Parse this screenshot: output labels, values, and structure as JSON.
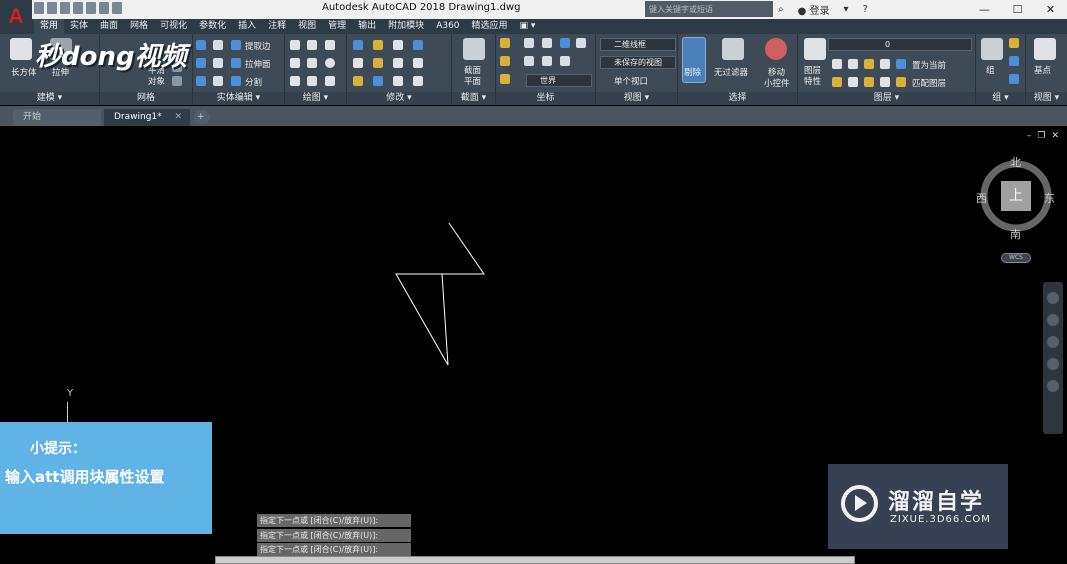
{
  "title_bar": {
    "app_letter": "A",
    "title": "Autodesk AutoCAD 2018    Drawing1.dwg",
    "search_placeholder": "键入关键字或短语",
    "login": "登录",
    "window_controls": [
      "—",
      "☐",
      "✕"
    ]
  },
  "ribbon_tabs": [
    "常用",
    "实体",
    "曲面",
    "网格",
    "可视化",
    "参数化",
    "插入",
    "注释",
    "视图",
    "管理",
    "输出",
    "附加模块",
    "A360",
    "精选应用"
  ],
  "ribbon": {
    "logo_text": "秒dong视频",
    "modeling": {
      "label": "建模 ▾",
      "box": "长方体",
      "extrude": "拉伸"
    },
    "mesh": {
      "label": "网格",
      "smooth": "平滑",
      "object": "对象"
    },
    "solid_edit": {
      "label": "实体编辑 ▾",
      "extract": "提取边",
      "extrude_face": "拉伸面",
      "split": "分割"
    },
    "draw": {
      "label": "绘图 ▾"
    },
    "modify": {
      "label": "修改 ▾"
    },
    "section": {
      "label": "截面 ▾",
      "plane1": "截面",
      "plane2": "平面"
    },
    "coordinates": {
      "label": "坐标",
      "world": "世界"
    },
    "view": {
      "label": "视图 ▾",
      "visual_style": "二维线框",
      "saved_view": "未保存的视图",
      "viewports": "单个视口"
    },
    "selection": {
      "label": "选择",
      "culling": "剔除",
      "no_filter": "无过滤器",
      "gizmo1": "移动",
      "gizmo2": "小控件"
    },
    "layers": {
      "label": "图层 ▾",
      "props1": "图层",
      "props2": "特性",
      "current_layer": "0",
      "set_current": "置为当前",
      "match": "匹配图层"
    },
    "groups": {
      "label": "组 ▾",
      "group": "组"
    },
    "view2": {
      "label": "视图 ▾",
      "base": "基点"
    }
  },
  "doc_tabs": [
    "开始",
    "Drawing1*"
  ],
  "viewport_controls": [
    "–",
    "❐",
    "✕"
  ],
  "viewcube": {
    "north": "北",
    "south": "南",
    "east": "东",
    "west": "西",
    "top": "上",
    "wcs": "WCS"
  },
  "ucs_y": "Y",
  "tip": {
    "title": "小提示：",
    "body": "输入att调用块属性设置"
  },
  "watermark": {
    "title": "溜溜自学",
    "url": "ZIXUE.3D66.COM"
  },
  "command_history": [
    "指定下一点或 [闭合(C)/放弃(U)]:",
    "指定下一点或 [闭合(C)/放弃(U)]:",
    "指定下一点或 [闭合(C)/放弃(U)]:"
  ],
  "colors": {
    "ribbon_bg": "#3e4a56",
    "tabbar_bg": "#2e3a46",
    "tip_bg": "#5fb3e6",
    "watermark_bg": "#3b4458",
    "canvas_bg": "#000000",
    "autocad_red": "#d51f26"
  }
}
